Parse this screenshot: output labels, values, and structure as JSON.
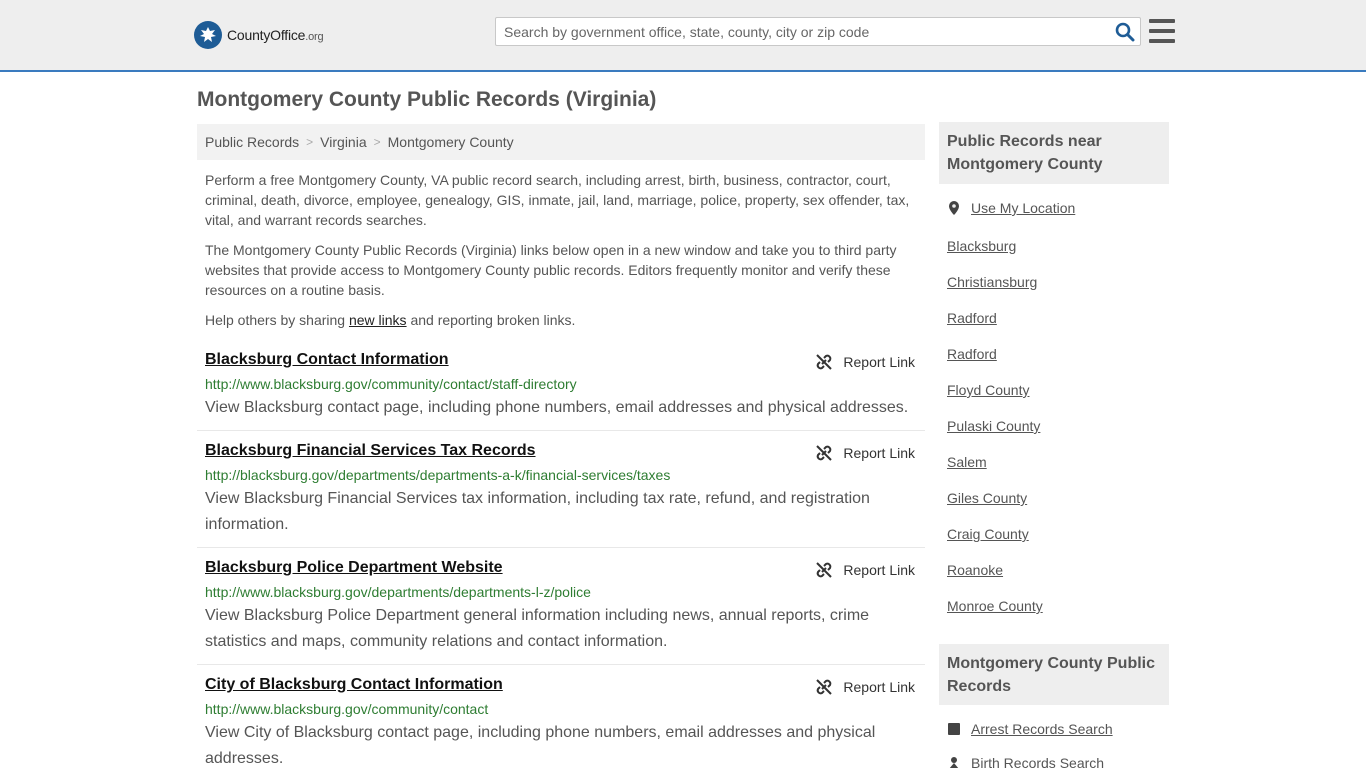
{
  "header": {
    "logo_main": "CountyOffice",
    "logo_tld": ".org",
    "search_placeholder": "Search by government office, state, county, city or zip code"
  },
  "page": {
    "title": "Montgomery County Public Records (Virginia)",
    "breadcrumb": [
      "Public Records",
      "Virginia",
      "Montgomery County"
    ],
    "intro_1": "Perform a free Montgomery County, VA public record search, including arrest, birth, business, contractor, court, criminal, death, divorce, employee, genealogy, GIS, inmate, jail, land, marriage, police, property, sex offender, tax, vital, and warrant records searches.",
    "intro_2": "The Montgomery County Public Records (Virginia) links below open in a new window and take you to third party websites that provide access to Montgomery County public records. Editors frequently monitor and verify these resources on a routine basis.",
    "help_prefix": "Help others by sharing ",
    "help_link": "new links",
    "help_suffix": " and reporting broken links.",
    "report_label": "Report Link"
  },
  "records": [
    {
      "title": "Blacksburg Contact Information",
      "url": "http://www.blacksburg.gov/community/contact/staff-directory",
      "desc": "View Blacksburg contact page, including phone numbers, email addresses and physical addresses."
    },
    {
      "title": "Blacksburg Financial Services Tax Records",
      "url": "http://blacksburg.gov/departments/departments-a-k/financial-services/taxes",
      "desc": "View Blacksburg Financial Services tax information, including tax rate, refund, and registration information."
    },
    {
      "title": "Blacksburg Police Department Website",
      "url": "http://www.blacksburg.gov/departments/departments-l-z/police",
      "desc": "View Blacksburg Police Department general information including news, annual reports, crime statistics and maps, community relations and contact information."
    },
    {
      "title": "City of Blacksburg Contact Information",
      "url": "http://www.blacksburg.gov/community/contact",
      "desc": "View City of Blacksburg contact page, including phone numbers, email addresses and physical addresses."
    }
  ],
  "sidebar": {
    "nearby_heading": "Public Records near Montgomery County",
    "use_location": "Use My Location",
    "nearby": [
      "Blacksburg",
      "Christiansburg",
      "Radford",
      "Radford",
      "Floyd County",
      "Pulaski County",
      "Salem",
      "Giles County",
      "Craig County",
      "Roanoke",
      "Monroe County"
    ],
    "county_heading": "Montgomery County Public Records",
    "county_links": [
      "Arrest Records Search",
      "Birth Records Search"
    ]
  },
  "colors": {
    "accent": "#3a7bbf",
    "logo_blue": "#1e5c96",
    "url_green": "#2e7d32"
  }
}
